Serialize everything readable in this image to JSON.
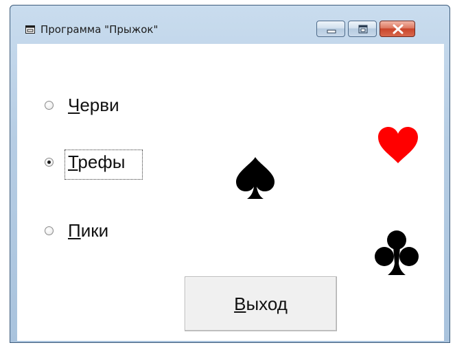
{
  "window": {
    "title": "Программа \"Прыжок\"",
    "icon": "app-window-icon",
    "controls": [
      "minimize-icon",
      "maximize-icon",
      "close-icon"
    ]
  },
  "radios": [
    {
      "first": "Ч",
      "rest": "ерви",
      "checked": false
    },
    {
      "first": "Т",
      "rest": "рефы",
      "checked": true
    },
    {
      "first": "П",
      "rest": "ики",
      "checked": false
    }
  ],
  "suits": [
    {
      "name": "heart",
      "glyph": "♥",
      "color": "#ff0000"
    },
    {
      "name": "spade",
      "glyph": "♠",
      "color": "#000000"
    },
    {
      "name": "club",
      "glyph": "♣",
      "color": "#000000"
    }
  ],
  "exit_button": {
    "first": "В",
    "rest": "ыход"
  }
}
